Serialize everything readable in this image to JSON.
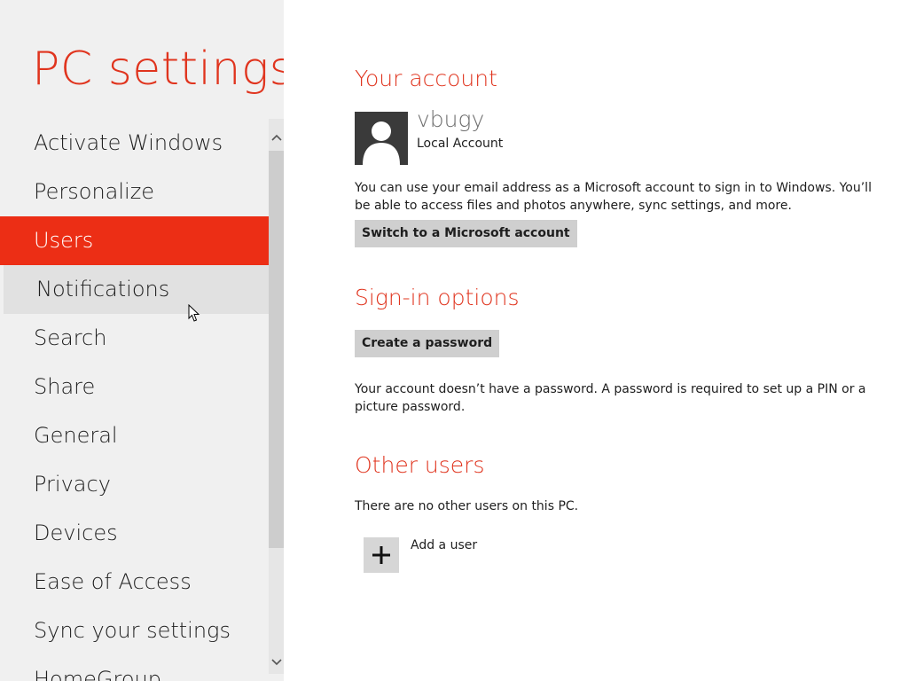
{
  "app_title": "PC settings",
  "nav": {
    "items": [
      {
        "label": "Activate Windows"
      },
      {
        "label": "Personalize"
      },
      {
        "label": "Users"
      },
      {
        "label": "Notifications"
      },
      {
        "label": "Search"
      },
      {
        "label": "Share"
      },
      {
        "label": "General"
      },
      {
        "label": "Privacy"
      },
      {
        "label": "Devices"
      },
      {
        "label": "Ease of Access"
      },
      {
        "label": "Sync your settings"
      },
      {
        "label": "HomeGroup"
      }
    ],
    "selected": "Users",
    "hovered": "Notifications"
  },
  "your_account": {
    "title": "Your account",
    "username": "vbugy",
    "account_type": "Local Account",
    "description": "You can use your email address as a Microsoft account to sign in to Windows. You’ll be able to access files and photos anywhere, sync settings, and more.",
    "switch_button": "Switch to a Microsoft account"
  },
  "sign_in_options": {
    "title": "Sign-in options",
    "create_password_button": "Create a password",
    "description": "Your account doesn’t have a password. A password is required to set up a PIN or a picture password."
  },
  "other_users": {
    "title": "Other users",
    "description": "There are no other users on this PC.",
    "add_user_label": "Add a user"
  },
  "colors": {
    "accent": "#e0341e",
    "selected_bg": "#ec2e15",
    "left_pane_bg": "#f0f0f0",
    "button_bg": "#cfcfcf"
  },
  "icons": {
    "avatar": "user-silhouette-icon",
    "add_user": "plus-icon",
    "scroll_up": "chevron-up-icon",
    "scroll_down": "chevron-down-icon",
    "cursor": "mouse-pointer-icon"
  }
}
